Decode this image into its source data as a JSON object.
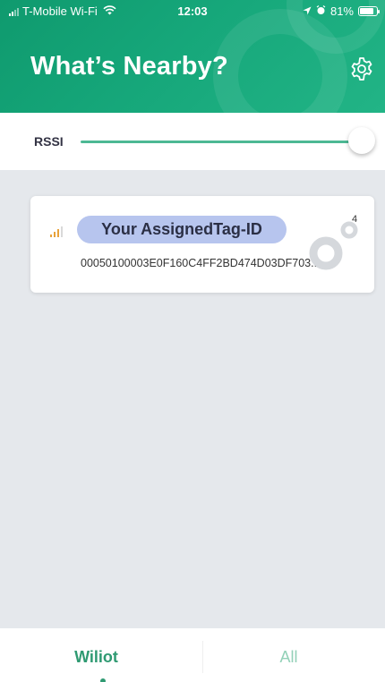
{
  "status_bar": {
    "carrier": "T-Mobile Wi-Fi",
    "time": "12:03",
    "battery_percent": "81%",
    "battery_level": 0.81
  },
  "header": {
    "title": "What’s Nearby?",
    "settings_icon": "gear-icon"
  },
  "rssi": {
    "label": "RSSI",
    "value_fraction": 1.0
  },
  "tags": [
    {
      "name": "Your AssignedTag-ID",
      "id": "00050100003E0F160C4FF2BD474D03DF703...",
      "count": "4",
      "signal_bars": 3
    }
  ],
  "tabs": {
    "wiliot": "Wiliot",
    "all": "All",
    "active": "wiliot"
  },
  "colors": {
    "header_green": "#16a77a",
    "accent_green": "#2f9a72",
    "pill_blue": "#b7c5ee",
    "signal_orange": "#e8a23a",
    "content_bg": "#e5e8ec"
  }
}
